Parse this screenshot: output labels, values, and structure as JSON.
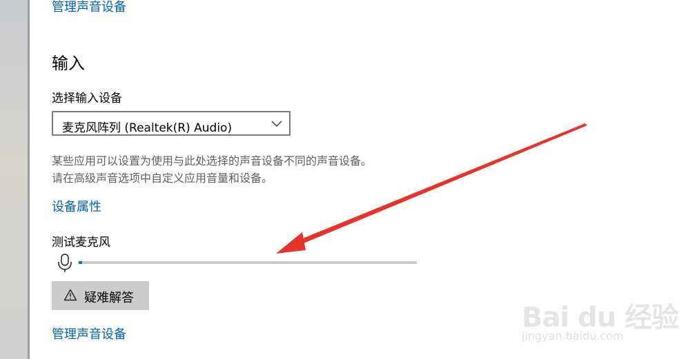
{
  "links": {
    "manage_sound_devices_top": "管理声音设备",
    "device_properties": "设备属性",
    "manage_sound_devices_bottom": "管理声音设备"
  },
  "input_section": {
    "heading": "输入",
    "select_label": "选择输入设备",
    "selected_device": "麦克风阵列 (Realtek(R) Audio)",
    "description_line1": "某些应用可以设置为使用与此处选择的声音设备不同的声音设备。",
    "description_line2": "请在高级声音选项中自定义应用音量和设备。",
    "test_mic_label": "测试麦克风",
    "mic_level_percent": 1,
    "troubleshoot_label": "疑难解答"
  },
  "colors": {
    "accent": "#0063b1",
    "level_fill": "#0078d7",
    "annotation_arrow": "#e8332a"
  },
  "icons": [
    "chevron-down-icon",
    "microphone-icon",
    "warning-icon"
  ],
  "watermark": {
    "logo_text": "Bai du 经验",
    "url": "jingyan.baidu.com"
  }
}
